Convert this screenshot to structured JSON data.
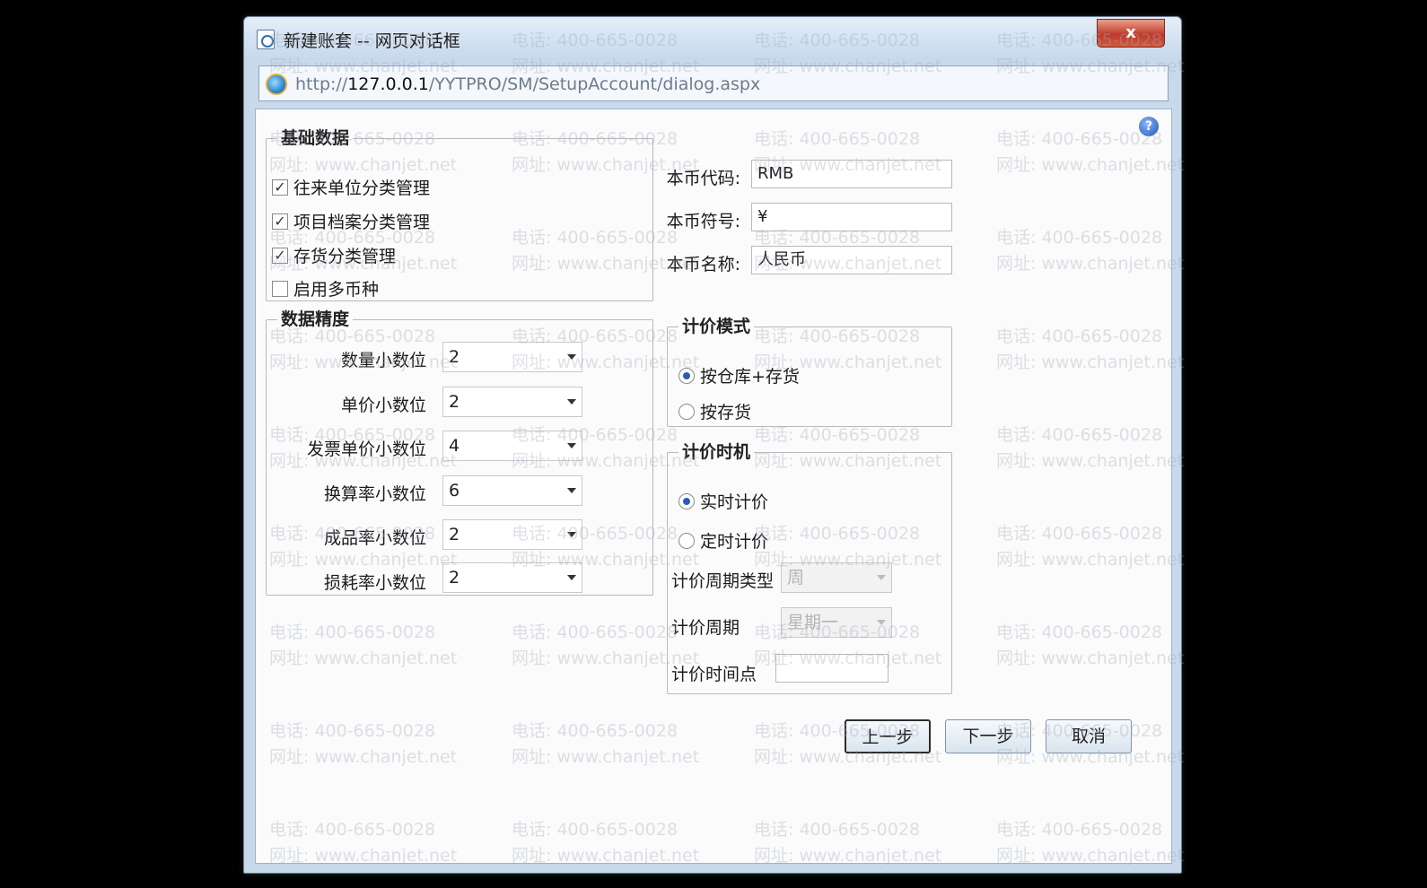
{
  "window": {
    "title": "新建账套 -- 网页对话框",
    "close_label": "x",
    "url_prefix": "http://",
    "url_host": "127.0.0.1",
    "url_path": "/YYTPRO/SM/SetupAccount/dialog.aspx"
  },
  "basic_data": {
    "legend": "基础数据",
    "options": [
      {
        "label": "往来单位分类管理",
        "checked": "✓"
      },
      {
        "label": "项目档案分类管理",
        "checked": "✓"
      },
      {
        "label": "存货分类管理",
        "checked": "✓"
      },
      {
        "label": "启用多币种",
        "checked": ""
      }
    ]
  },
  "precision": {
    "legend": "数据精度",
    "rows": [
      {
        "label": "数量小数位",
        "value": "2"
      },
      {
        "label": "单价小数位",
        "value": "2"
      },
      {
        "label": "发票单价小数位",
        "value": "4"
      },
      {
        "label": "换算率小数位",
        "value": "6"
      },
      {
        "label": "成品率小数位",
        "value": "2"
      },
      {
        "label": "损耗率小数位",
        "value": "2"
      }
    ]
  },
  "currency": {
    "code_label": "本币代码:",
    "code_value": "RMB",
    "symbol_label": "本币符号:",
    "symbol_value": "¥",
    "name_label": "本币名称:",
    "name_value": "人民币"
  },
  "pricing_mode": {
    "legend": "计价模式",
    "options": [
      {
        "label": "按仓库+存货",
        "selected": true
      },
      {
        "label": "按存货",
        "selected": false
      }
    ]
  },
  "pricing_timing": {
    "legend": "计价时机",
    "options": [
      {
        "label": "实时计价",
        "selected": true
      },
      {
        "label": "定时计价",
        "selected": false
      }
    ],
    "period_type_label": "计价周期类型",
    "period_type_value": "周",
    "period_label": "计价周期",
    "period_value": "星期一",
    "time_label": "计价时间点",
    "time_value": ""
  },
  "buttons": {
    "prev": "上一步",
    "next": "下一步",
    "cancel": "取消"
  },
  "watermark": {
    "phone": "电话: 400-665-0028",
    "site": "网址: www.chanjet.net"
  },
  "colors": {
    "close": "#c0392b",
    "frame": "#c8d9ec",
    "radio_selected": "#2a5db0"
  }
}
